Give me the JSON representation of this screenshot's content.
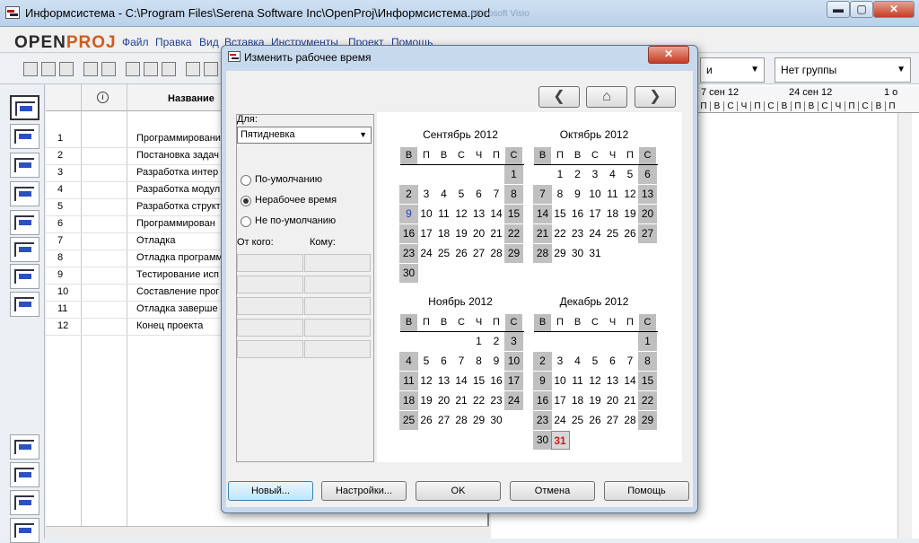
{
  "window": {
    "title": "Информсистема - C:\\Program Files\\Serena Software Inc\\OpenProj\\Информсистема.pod",
    "background_window_title": "Microsoft Visio",
    "min_glyph": "▬",
    "max_glyph": "▢",
    "close_glyph": "✕"
  },
  "logo": {
    "prefix": "OPEN",
    "suffix": "PROJ"
  },
  "menu": [
    "Файл",
    "Правка",
    "Вид",
    "Вставка",
    "Инструменты",
    "Проект",
    "Помощь"
  ],
  "toolbar": {
    "filter_value": "и",
    "group_value": "Нет группы"
  },
  "table": {
    "header_name": "Название",
    "info_glyph": "i",
    "rows": [
      {
        "n": "1",
        "name": "Программирование"
      },
      {
        "n": "2",
        "name": "Постановка задач"
      },
      {
        "n": "3",
        "name": "Разработка интер"
      },
      {
        "n": "4",
        "name": "Разработка модул"
      },
      {
        "n": "5",
        "name": "Разработка структ"
      },
      {
        "n": "6",
        "name": "Программирован"
      },
      {
        "n": "7",
        "name": "Отладка"
      },
      {
        "n": "8",
        "name": "Отладка программ"
      },
      {
        "n": "9",
        "name": "Тестирование исп"
      },
      {
        "n": "10",
        "name": "Составление прог"
      },
      {
        "n": "11",
        "name": "Отладка заверше"
      },
      {
        "n": "12",
        "name": "Конец проекта"
      }
    ]
  },
  "gantt": {
    "weeks": [
      "7 сен 12",
      "24 сен 12",
      "1 о"
    ],
    "days": [
      "П",
      "В",
      "С",
      "Ч",
      "П",
      "С",
      "В",
      "П",
      "В",
      "С",
      "Ч",
      "П",
      "С",
      "В",
      "П"
    ]
  },
  "dialog": {
    "title": "Изменить рабочее время",
    "close_glyph": "✕",
    "prev_glyph": "❮",
    "home_glyph": "⌂",
    "next_glyph": "❯",
    "for_label": "Для:",
    "for_value": "Пятидневка",
    "radios": [
      {
        "label": "По-умолчанию",
        "checked": false
      },
      {
        "label": "Нерабочее время",
        "checked": true
      },
      {
        "label": "Не по-умолчанию",
        "checked": false
      }
    ],
    "from_label": "От кого:",
    "to_label": "Кому:",
    "buttons": {
      "new": "Новый...",
      "settings": "Настройки...",
      "ok": "OK",
      "cancel": "Отмена",
      "help": "Помощь"
    },
    "weekday_headers": [
      "В",
      "П",
      "В",
      "С",
      "Ч",
      "П",
      "С"
    ],
    "months": [
      {
        "title": "Сентябрь 2012",
        "start": 6,
        "days": 30,
        "highlight": [
          9
        ],
        "today": null
      },
      {
        "title": "Октябрь 2012",
        "start": 1,
        "days": 31,
        "highlight": [],
        "today": null
      },
      {
        "title": "Ноябрь 2012",
        "start": 4,
        "days": 30,
        "highlight": [],
        "today": null
      },
      {
        "title": "Декабрь 2012",
        "start": 6,
        "days": 31,
        "highlight": [],
        "today": 31
      }
    ]
  }
}
